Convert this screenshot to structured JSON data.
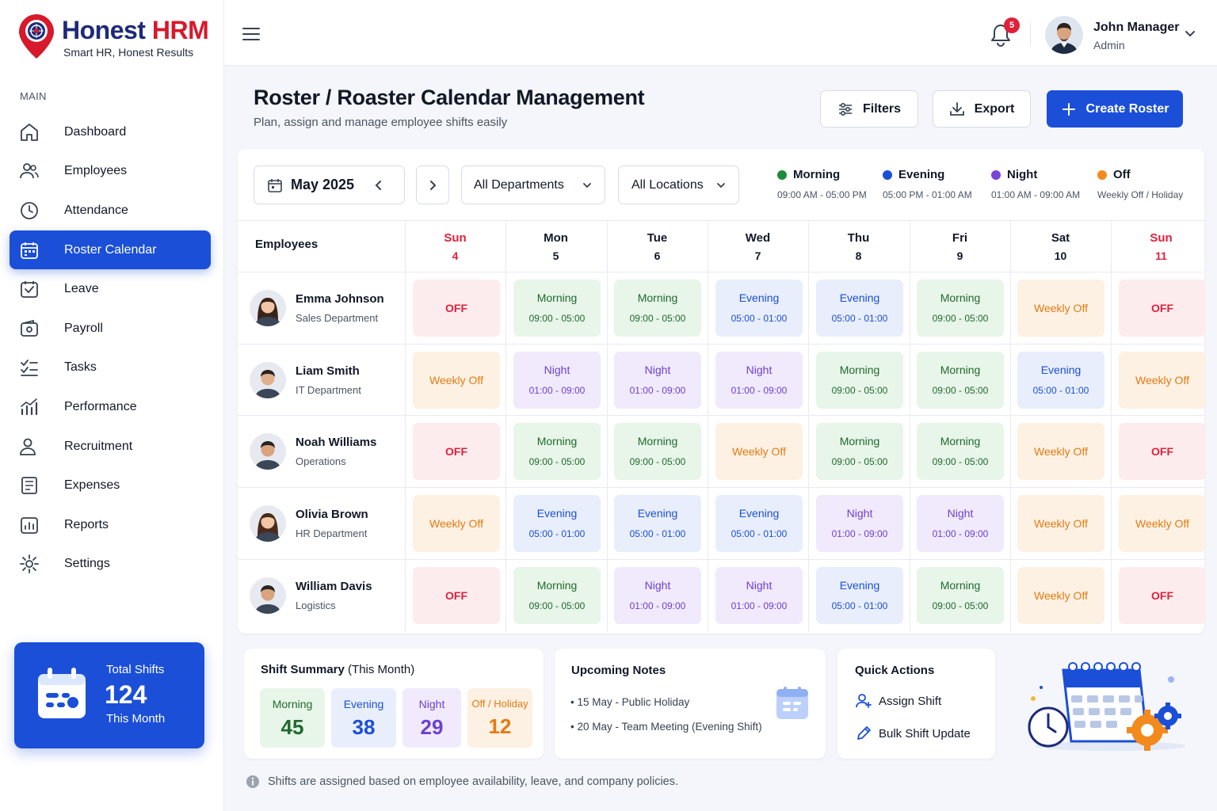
{
  "brand": {
    "name_part1": "Honest",
    "name_part2": "HRM",
    "tagline": "Smart HR, Honest Results"
  },
  "sidebar": {
    "section_label": "MAIN",
    "items": [
      {
        "label": "Dashboard",
        "icon": "home-icon",
        "active": false
      },
      {
        "label": "Employees",
        "icon": "users-icon",
        "active": false
      },
      {
        "label": "Attendance",
        "icon": "clock-icon",
        "active": false
      },
      {
        "label": "Roster Calendar",
        "icon": "calendar-icon",
        "active": true
      },
      {
        "label": "Leave",
        "icon": "calendar-check-icon",
        "active": false
      },
      {
        "label": "Payroll",
        "icon": "wallet-icon",
        "active": false
      },
      {
        "label": "Tasks",
        "icon": "checklist-icon",
        "active": false
      },
      {
        "label": "Performance",
        "icon": "bar-chart-icon",
        "active": false
      },
      {
        "label": "Recruitment",
        "icon": "user-plus-icon",
        "active": false
      },
      {
        "label": "Expenses",
        "icon": "receipt-icon",
        "active": false
      },
      {
        "label": "Reports",
        "icon": "report-icon",
        "active": false
      },
      {
        "label": "Settings",
        "icon": "gear-icon",
        "active": false
      }
    ],
    "total_card": {
      "label": "Total Shifts",
      "value": "124",
      "period": "This Month"
    }
  },
  "topbar": {
    "notification_count": "5",
    "user": {
      "name": "John Manager",
      "role": "Admin"
    }
  },
  "header": {
    "title": "Roster / Roaster Calendar Management",
    "subtitle": "Plan, assign and manage employee shifts easily",
    "filters_label": "Filters",
    "export_label": "Export",
    "create_label": "Create Roster"
  },
  "controls": {
    "month": "May 2025",
    "department": "All Departments",
    "location": "All Locations"
  },
  "legend": [
    {
      "name": "Morning",
      "time": "09:00 AM - 05:00 PM",
      "color": "#1e8a3c"
    },
    {
      "name": "Evening",
      "time": "05:00 PM - 01:00 AM",
      "color": "#1b4fd8"
    },
    {
      "name": "Night",
      "time": "01:00 AM - 09:00 AM",
      "color": "#7a44d6"
    },
    {
      "name": "Off",
      "time": "Weekly Off / Holiday",
      "color": "#f28a1e"
    }
  ],
  "roster": {
    "employees_header": "Employees",
    "days": [
      {
        "name": "Sun",
        "date": "4",
        "weekend": true
      },
      {
        "name": "Mon",
        "date": "5",
        "weekend": false
      },
      {
        "name": "Tue",
        "date": "6",
        "weekend": false
      },
      {
        "name": "Wed",
        "date": "7",
        "weekend": false
      },
      {
        "name": "Thu",
        "date": "8",
        "weekend": false
      },
      {
        "name": "Fri",
        "date": "9",
        "weekend": false
      },
      {
        "name": "Sat",
        "date": "10",
        "weekend": false
      },
      {
        "name": "Sun",
        "date": "11",
        "weekend": true
      }
    ],
    "rows": [
      {
        "name": "Emma Johnson",
        "dept": "Sales Department",
        "shifts": [
          {
            "type": "off",
            "label": "OFF",
            "time": ""
          },
          {
            "type": "morning",
            "label": "Morning",
            "time": "09:00 - 05:00"
          },
          {
            "type": "morning",
            "label": "Morning",
            "time": "09:00 - 05:00"
          },
          {
            "type": "evening",
            "label": "Evening",
            "time": "05:00 - 01:00"
          },
          {
            "type": "evening",
            "label": "Evening",
            "time": "05:00 - 01:00"
          },
          {
            "type": "morning",
            "label": "Morning",
            "time": "09:00 - 05:00"
          },
          {
            "type": "weekly",
            "label": "Weekly Off",
            "time": ""
          },
          {
            "type": "off",
            "label": "OFF",
            "time": ""
          }
        ]
      },
      {
        "name": "Liam Smith",
        "dept": "IT Department",
        "shifts": [
          {
            "type": "weekly",
            "label": "Weekly Off",
            "time": ""
          },
          {
            "type": "night",
            "label": "Night",
            "time": "01:00 - 09:00"
          },
          {
            "type": "night",
            "label": "Night",
            "time": "01:00 - 09:00"
          },
          {
            "type": "night",
            "label": "Night",
            "time": "01:00 - 09:00"
          },
          {
            "type": "morning",
            "label": "Morning",
            "time": "09:00 - 05:00"
          },
          {
            "type": "morning",
            "label": "Morning",
            "time": "09:00 - 05:00"
          },
          {
            "type": "evening",
            "label": "Evening",
            "time": "05:00 - 01:00"
          },
          {
            "type": "weekly",
            "label": "Weekly Off",
            "time": ""
          }
        ]
      },
      {
        "name": "Noah Williams",
        "dept": "Operations",
        "shifts": [
          {
            "type": "off",
            "label": "OFF",
            "time": ""
          },
          {
            "type": "morning",
            "label": "Morning",
            "time": "09:00 - 05:00"
          },
          {
            "type": "morning",
            "label": "Morning",
            "time": "09:00 - 05:00"
          },
          {
            "type": "weekly",
            "label": "Weekly Off",
            "time": ""
          },
          {
            "type": "morning",
            "label": "Morning",
            "time": "09:00 - 05:00"
          },
          {
            "type": "morning",
            "label": "Morning",
            "time": "09:00 - 05:00"
          },
          {
            "type": "weekly",
            "label": "Weekly Off",
            "time": ""
          },
          {
            "type": "off",
            "label": "OFF",
            "time": ""
          }
        ]
      },
      {
        "name": "Olivia Brown",
        "dept": "HR Department",
        "shifts": [
          {
            "type": "weekly",
            "label": "Weekly Off",
            "time": ""
          },
          {
            "type": "evening",
            "label": "Evening",
            "time": "05:00 - 01:00"
          },
          {
            "type": "evening",
            "label": "Evening",
            "time": "05:00 - 01:00"
          },
          {
            "type": "evening",
            "label": "Evening",
            "time": "05:00 - 01:00"
          },
          {
            "type": "night",
            "label": "Night",
            "time": "01:00 - 09:00"
          },
          {
            "type": "night",
            "label": "Night",
            "time": "01:00 - 09:00"
          },
          {
            "type": "weekly",
            "label": "Weekly Off",
            "time": ""
          },
          {
            "type": "weekly",
            "label": "Weekly Off",
            "time": ""
          }
        ]
      },
      {
        "name": "William Davis",
        "dept": "Logistics",
        "shifts": [
          {
            "type": "off",
            "label": "OFF",
            "time": ""
          },
          {
            "type": "morning",
            "label": "Morning",
            "time": "09:00 - 05:00"
          },
          {
            "type": "night",
            "label": "Night",
            "time": "01:00 - 09:00"
          },
          {
            "type": "night",
            "label": "Night",
            "time": "01:00 - 09:00"
          },
          {
            "type": "evening",
            "label": "Evening",
            "time": "05:00 - 01:00"
          },
          {
            "type": "morning",
            "label": "Morning",
            "time": "09:00 - 05:00"
          },
          {
            "type": "weekly",
            "label": "Weekly Off",
            "time": ""
          },
          {
            "type": "off",
            "label": "OFF",
            "time": ""
          }
        ]
      }
    ]
  },
  "summary": {
    "title": "Shift Summary",
    "title_suffix": "(This Month)",
    "items": [
      {
        "label": "Morning",
        "value": "45"
      },
      {
        "label": "Evening",
        "value": "38"
      },
      {
        "label": "Night",
        "value": "29"
      },
      {
        "label": "Off / Holiday",
        "value": "12"
      }
    ]
  },
  "notes": {
    "title": "Upcoming Notes",
    "items": [
      "15 May - Public Holiday",
      "20 May - Team Meeting (Evening Shift)"
    ]
  },
  "quick_actions": {
    "title": "Quick Actions",
    "items": [
      "Assign Shift",
      "Bulk Shift Update"
    ]
  },
  "footnote": "Shifts are assigned based on employee availability, leave, and company policies."
}
